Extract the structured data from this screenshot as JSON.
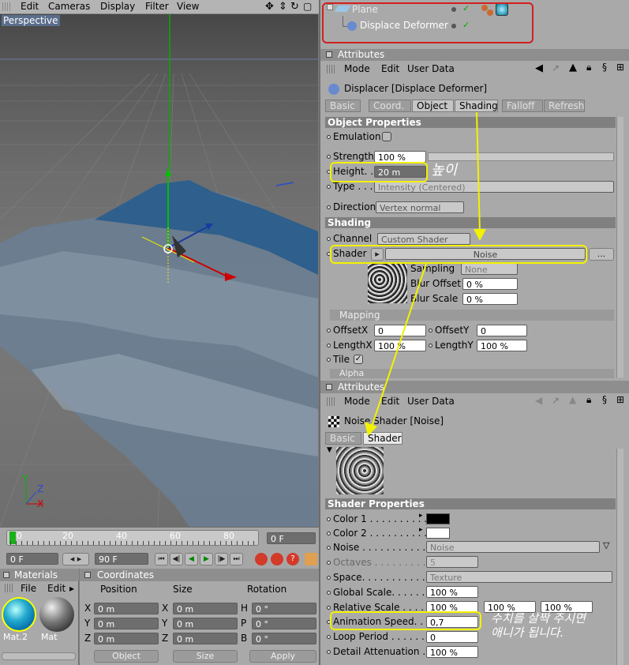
{
  "menu": {
    "items": [
      "Edit",
      "Cameras",
      "Display",
      "Filter",
      "View"
    ]
  },
  "viewport": {
    "label": "Perspective",
    "axis": {
      "x": "X",
      "y": "Y",
      "z": "Z"
    }
  },
  "timeline": {
    "ruler": [
      "0",
      "20",
      "40",
      "60",
      "80"
    ],
    "current_frame": "0 F",
    "start_frame": "0 F",
    "end_frame": "90 F"
  },
  "materials": {
    "title": "Materials",
    "menu": [
      "File",
      "Edit"
    ],
    "items": [
      "Mat.2",
      "Mat"
    ]
  },
  "coordinates": {
    "title": "Coordinates",
    "headers": [
      "Position",
      "Size",
      "Rotation"
    ],
    "rows": [
      {
        "p_axis": "X",
        "p_val": "0 m",
        "s_axis": "X",
        "s_val": "0 m",
        "r_axis": "H",
        "r_val": "0 °"
      },
      {
        "p_axis": "Y",
        "p_val": "0 m",
        "s_axis": "Y",
        "s_val": "0 m",
        "r_axis": "P",
        "r_val": "0 °"
      },
      {
        "p_axis": "Z",
        "p_val": "0 m",
        "s_axis": "Z",
        "s_val": "0 m",
        "r_axis": "B",
        "r_val": "0 °"
      }
    ],
    "mode_left": "Object",
    "mode_mid": "Size",
    "apply": "Apply"
  },
  "objects": {
    "items": [
      "Plane",
      "Displace Deformer"
    ]
  },
  "attr1": {
    "title": "Attributes",
    "menu": [
      "Mode",
      "Edit",
      "User Data"
    ],
    "object_title": "Displacer [Displace Deformer]",
    "tabs": [
      "Basic",
      "Coord.",
      "Object",
      "Shading",
      "Falloff",
      "Refresh"
    ],
    "object_props": "Object Properties",
    "emulation": "Emulation",
    "strength_label": "Strength",
    "strength_val": "100 %",
    "height_label": "Height. .",
    "height_val": "20 m",
    "type_label": "Type . . .",
    "type_val": "Intensity (Centered)",
    "direction_label": "Direction",
    "direction_val": "Vertex normal",
    "shading_hdr": "Shading",
    "channel_label": "Channel",
    "channel_val": "Custom Shader",
    "shader_label": "Shader",
    "shader_val": "Noise",
    "more": "...",
    "sampling_label": "Sampling",
    "sampling_val": "None",
    "bluroff_label": "Blur Offset",
    "bluroff_val": "0 %",
    "blurscale_label": "Blur Scale",
    "blurscale_val": "0 %",
    "mapping": "Mapping",
    "offx_label": "OffsetX",
    "offx_val": "0",
    "offy_label": "OffsetY",
    "offy_val": "0",
    "lenx_label": "LengthX",
    "lenx_val": "100 %",
    "leny_label": "LengthY",
    "leny_val": "100 %",
    "tile_label": "Tile",
    "alpha": "Alpha"
  },
  "annot_height": "높이",
  "attr2": {
    "title": "Attributes",
    "menu": [
      "Mode",
      "Edit",
      "User Data"
    ],
    "object_title": "Noise Shader [Noise]",
    "tabs": [
      "Basic",
      "Shader"
    ],
    "props": "Shader Properties",
    "rows": [
      {
        "label": "Color 1 . . . . . . . . . . .",
        "val": ""
      },
      {
        "label": "Color 2 . . . . . . . . . . .",
        "val": ""
      },
      {
        "label": "Noise . . . . . . . . . . . .",
        "val": "Noise"
      },
      {
        "label": "Octaves . . . . . . . . . . .",
        "val": "5"
      },
      {
        "label": "Space. . . . . . . . . . . .",
        "val": "Texture"
      },
      {
        "label": "Global Scale. . . . . . . .",
        "val": "100 %"
      },
      {
        "label": "Relative Scale . . . . . .",
        "val": "100 %"
      },
      {
        "label": "Animation Speed. . . . .",
        "val": "0,7"
      },
      {
        "label": "Loop Period . . . . . . . .",
        "val": "0"
      },
      {
        "label": "Detail Attenuation . . .",
        "val": "100 %"
      }
    ],
    "rel2": "100 %",
    "rel3": "100 %"
  },
  "annot_speed": [
    "수치를 살짝 주시면",
    "애니가 됩니다."
  ],
  "colors": {
    "highlight": "#f2f200",
    "water": "#3d6e9c"
  }
}
